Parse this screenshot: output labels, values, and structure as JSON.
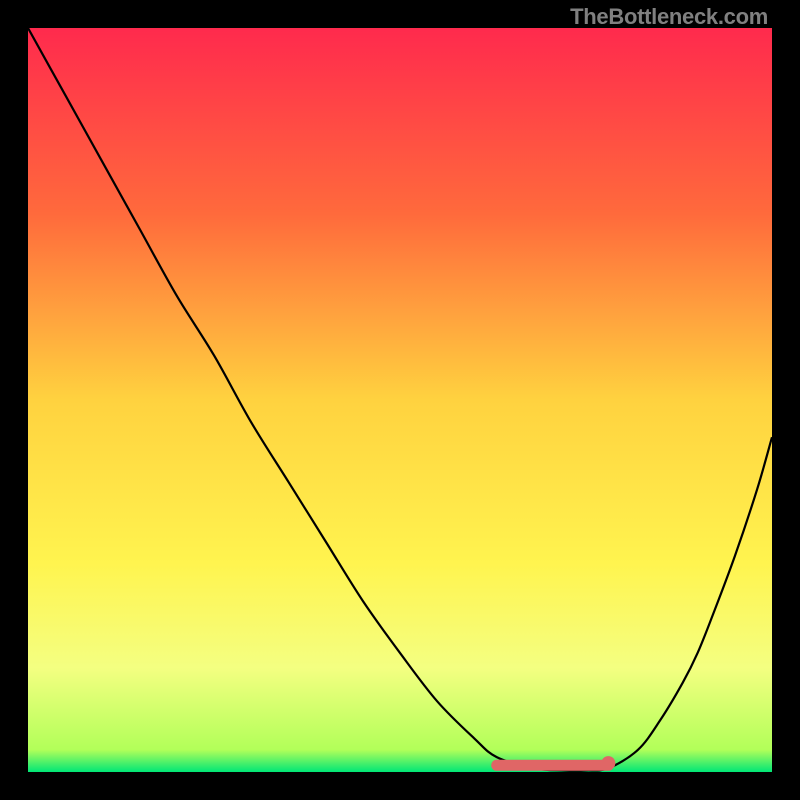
{
  "attribution": "TheBottleneck.com",
  "chart_data": {
    "type": "line",
    "title": "",
    "xlabel": "",
    "ylabel": "",
    "xlim": [
      0,
      100
    ],
    "ylim": [
      0,
      100
    ],
    "gradient_stops": [
      {
        "offset": 0,
        "color": "#ff2a4d"
      },
      {
        "offset": 25,
        "color": "#ff6a3c"
      },
      {
        "offset": 50,
        "color": "#ffd23f"
      },
      {
        "offset": 72,
        "color": "#fff44f"
      },
      {
        "offset": 86,
        "color": "#f4ff81"
      },
      {
        "offset": 97,
        "color": "#b2ff59"
      },
      {
        "offset": 100,
        "color": "#00e676"
      }
    ],
    "series": [
      {
        "name": "bottleneck-curve",
        "x": [
          0,
          5,
          10,
          15,
          20,
          25,
          30,
          35,
          40,
          45,
          50,
          55,
          60,
          63,
          68,
          72,
          75,
          78,
          82,
          85,
          88,
          90,
          92,
          95,
          98,
          100
        ],
        "y": [
          100,
          91,
          82,
          73,
          64,
          56,
          47,
          39,
          31,
          23,
          16,
          9.5,
          4.5,
          2.0,
          0.5,
          0.2,
          0.2,
          0.5,
          3.0,
          7.0,
          12,
          16,
          21,
          29,
          38,
          45
        ]
      }
    ],
    "optimal_marker": {
      "x_start": 63,
      "x_end": 78,
      "y": 0.9,
      "dot_x": 78,
      "dot_y": 1.2
    }
  }
}
